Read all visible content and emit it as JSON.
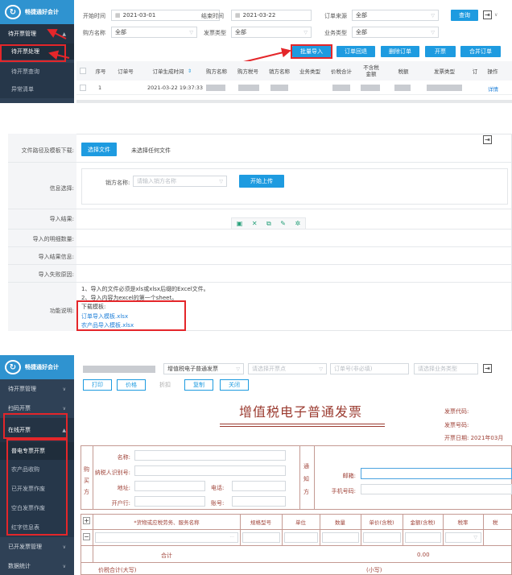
{
  "panel1": {
    "sidebar": {
      "app_name": "畅捷通好会计",
      "items": [
        {
          "label": "待开票管理",
          "state": "expanded"
        },
        {
          "label": "待开票处理",
          "state": "selected"
        },
        {
          "label": "待开票查询",
          "state": "sub"
        },
        {
          "label": "异常清单",
          "state": "sub"
        }
      ]
    },
    "filters": {
      "start_time_label": "开始时间",
      "start_time_value": "2021-03-01",
      "end_time_label": "结束时间",
      "end_time_value": "2021-03-22",
      "order_source_label": "订单来源",
      "order_source_value": "全部",
      "query_button": "查询",
      "seller_label": "购方名称",
      "seller_value": "全部",
      "invoice_type_label": "发票类型",
      "invoice_type_value": "全部",
      "business_type_label": "业务类型",
      "business_type_value": "全部"
    },
    "actions": [
      "批量导入",
      "订单回退",
      "删除订单",
      "开票",
      "合并订单"
    ],
    "table": {
      "headers": [
        "序号",
        "订单号",
        "订单生成时间",
        "购方名称",
        "购方税号",
        "销方名称",
        "业务类型",
        "价税合计",
        "不含税金额",
        "税额",
        "发票类型",
        "订",
        "操作"
      ],
      "rows": [
        {
          "index": "1",
          "time": "2021-03-22 19:37:33",
          "action": "详情"
        }
      ]
    }
  },
  "panel2": {
    "rows": {
      "file_label": "文件路径及模板下载:",
      "choose_button": "选择文件",
      "no_file": "未选择任何文件",
      "info_label": "信息选择:",
      "seller_label": "销方名称:",
      "seller_placeholder": "请输入销方名称",
      "upload_button": "开始上传",
      "result_label": "导入结果:",
      "detail_count_label": "导入的明细数量:",
      "result_info_label": "导入结果信息:",
      "fail_reason_label": "导入失败原因:",
      "help_label": "功能说明:",
      "help_lines": [
        "1、导入的文件必须是xls或xlsx后缀的Excel文件。",
        "2、导入内容为excel的第一个sheet。"
      ],
      "download_label": "下载模板:",
      "templates": [
        "订单导入模板.xlsx",
        "农产品导入模板.xlsx"
      ]
    }
  },
  "panel3": {
    "sidebar": {
      "app_name": "畅捷通好会计",
      "items": [
        {
          "label": "待开票管理",
          "state": "collapsed"
        },
        {
          "label": "扫码开票",
          "state": "collapsed"
        },
        {
          "label": "在线开票",
          "state": "expanded"
        },
        {
          "label": "普电专票开票",
          "state": "selected"
        },
        {
          "label": "农产品收购",
          "state": "sub"
        },
        {
          "label": "已开发票作废",
          "state": "sub"
        },
        {
          "label": "空白发票作废",
          "state": "sub"
        },
        {
          "label": "红字信息表",
          "state": "sub"
        },
        {
          "label": "已开发票管理",
          "state": "collapsed"
        },
        {
          "label": "数据统计",
          "state": "collapsed"
        }
      ]
    },
    "top": {
      "invoice_kind": "增值税电子普通发票",
      "point_placeholder": "请选择开票点",
      "order_placeholder": "订单号(非必填)",
      "business_placeholder": "请选择业务类型"
    },
    "toolbar": [
      "打印",
      "价格",
      "折扣",
      "复制",
      "关闭"
    ],
    "invoice": {
      "title": "增值税电子普通发票",
      "code_label": "发票代码:",
      "number_label": "发票号码:",
      "date_label": "开票日期:",
      "date_value": "2021年03月",
      "buyer_section": "购买方",
      "notify_section": "通知方",
      "name_label": "名称:",
      "tax_id_label": "纳税人识别号:",
      "address_label": "地址:",
      "phone_label": "电话:",
      "bank_label": "开户行:",
      "account_label": "账号:",
      "email_label": "邮箱:",
      "mobile_label": "手机号码:",
      "cols": [
        "*货物或应税劳务、服务名称",
        "规格型号",
        "单位",
        "数量",
        "单价(含税)",
        "金额(含税)",
        "税率",
        "税"
      ],
      "total_label": "合计",
      "total_value": "0.00",
      "grand_total_label": "价税合计(大写)",
      "grand_total_small": "(小写)"
    }
  }
}
